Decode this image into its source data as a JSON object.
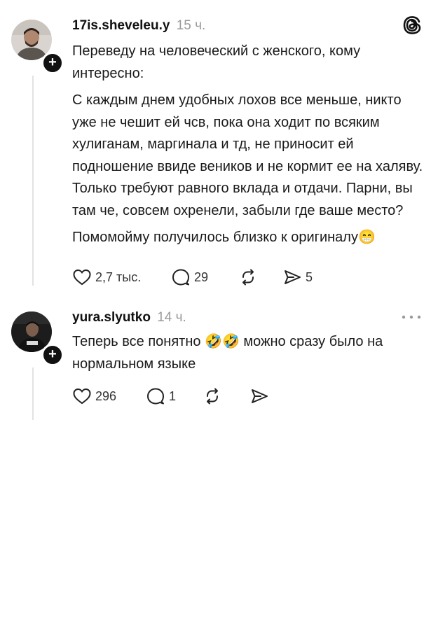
{
  "posts": [
    {
      "username": "17is.sheveleu.y",
      "time": "15 ч.",
      "paragraphs": [
        "Переведу на человеческий с женского, кому интересно:",
        "С каждым днем удобных лохов все меньше, никто уже не чешит ей чсв, пока она ходит по всяким хулиганам, маргинала и тд, не приносит ей подношение ввиде веников и не кормит ее на халяву. Только требуют равного вклада и отдачи. Парни, вы там че, совсем охренели, забыли где ваше место?",
        "Помомойму получилось близко к оригиналу😁"
      ],
      "likes": "2,7 тыс.",
      "comments": "29",
      "shares": "5"
    },
    {
      "username": "yura.slyutko",
      "time": "14 ч.",
      "paragraphs": [
        "Теперь все понятно 🤣🤣 можно сразу было на нормальном языке"
      ],
      "likes": "296",
      "comments": "1"
    }
  ],
  "icons": {
    "app_logo": "threads-logo-icon",
    "avatar_badge": "plus-icon",
    "like": "heart-icon",
    "comment": "comment-icon",
    "repost": "repost-icon",
    "share": "send-icon",
    "more": "more-icon"
  }
}
